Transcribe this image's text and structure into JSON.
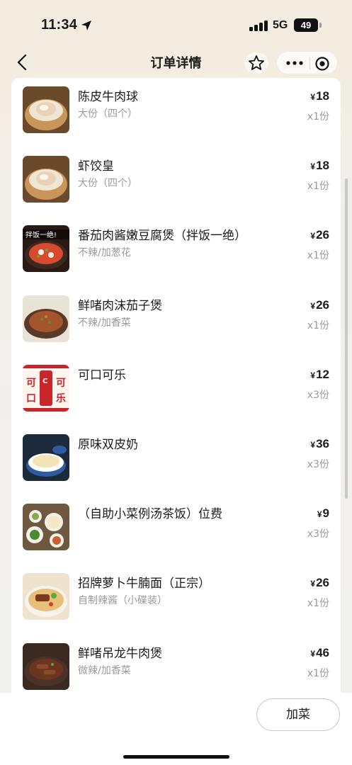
{
  "status_bar": {
    "time": "11:34",
    "network": "5G",
    "battery": "49"
  },
  "nav": {
    "title": "订单详情"
  },
  "icons": {
    "back": "chevron-left-icon",
    "star": "star-icon",
    "more": "more-dots-icon",
    "close": "target-circle-icon",
    "location": "location-arrow-icon"
  },
  "order": {
    "items": [
      {
        "name": "陈皮牛肉球",
        "spec": "大份（四个）",
        "currency": "¥",
        "price": "18",
        "qty": "x1份",
        "thumb": "dumpling-basket"
      },
      {
        "name": "虾饺皇",
        "spec": "大份（四个）",
        "currency": "¥",
        "price": "18",
        "qty": "x1份",
        "thumb": "dumpling-basket"
      },
      {
        "name": "番茄肉酱嫩豆腐煲（拌饭一绝）",
        "spec": "不辣/加葱花",
        "currency": "¥",
        "price": "26",
        "qty": "x1份",
        "thumb": "claypot-red",
        "thumb_label": "拌饭一绝!"
      },
      {
        "name": "鲜啫肉沫茄子煲",
        "spec": "不辣/加香菜",
        "currency": "¥",
        "price": "26",
        "qty": "x1份",
        "thumb": "claypot-brown"
      },
      {
        "name": "可口可乐",
        "spec": "",
        "currency": "¥",
        "price": "12",
        "qty": "x3份",
        "thumb": "cola",
        "thumb_label": [
          "可",
          "可",
          "口",
          "乐"
        ]
      },
      {
        "name": "原味双皮奶",
        "spec": "",
        "currency": "¥",
        "price": "36",
        "qty": "x3份",
        "thumb": "milk-pudding"
      },
      {
        "name": "（自助小菜例汤茶饭）位费",
        "spec": "",
        "currency": "¥",
        "price": "9",
        "qty": "x3份",
        "thumb": "side-dishes"
      },
      {
        "name": "招牌萝卜牛腩面（正宗）",
        "spec": "自制辣酱（小碟装）",
        "currency": "¥",
        "price": "26",
        "qty": "x1份",
        "thumb": "noodle-bowl"
      },
      {
        "name": "鲜啫吊龙牛肉煲",
        "spec": "微辣/加香菜",
        "currency": "¥",
        "price": "46",
        "qty": "x1份",
        "thumb": "claypot-beef"
      }
    ]
  },
  "bottom_bar": {
    "add_label": "加菜"
  },
  "colors": {
    "accent_red": "#c8262b",
    "bg_warm": "#f3ece1",
    "text_gray": "#9a9a9a"
  }
}
